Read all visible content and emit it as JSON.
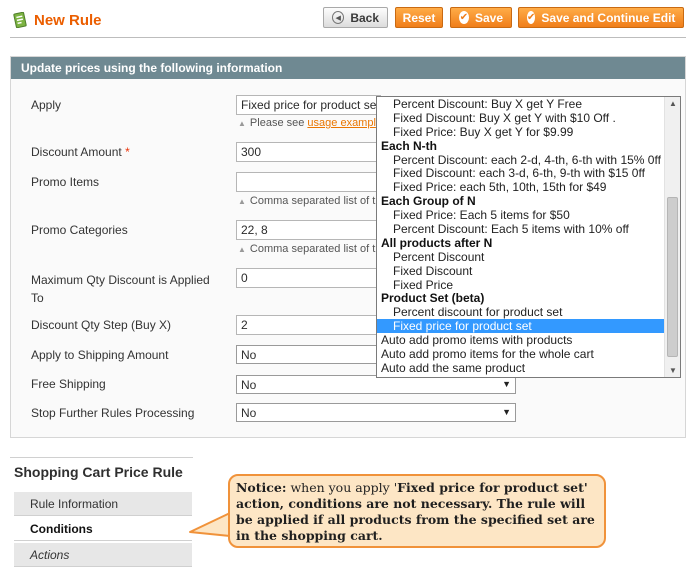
{
  "header": {
    "title": "New Rule",
    "buttons": {
      "back": "Back",
      "reset": "Reset",
      "save": "Save",
      "save_continue": "Save and Continue Edit"
    }
  },
  "section": {
    "title": "Update prices using the following information"
  },
  "form": {
    "apply": {
      "label": "Apply",
      "value": "Fixed price for product set",
      "note_prefix": "Please see",
      "note_link": "usage exampl"
    },
    "discount_amount": {
      "label": "Discount Amount",
      "required_mark": "*",
      "value": "300"
    },
    "promo_items": {
      "label": "Promo Items",
      "value": "",
      "note": "Comma separated list of th"
    },
    "promo_categories": {
      "label": "Promo Categories",
      "value": "22, 8",
      "note": "Comma separated list of th"
    },
    "max_qty": {
      "label_line1": "Maximum Qty Discount is Applied",
      "label_line2": "To",
      "value": "0"
    },
    "discount_qty_step": {
      "label": "Discount Qty Step (Buy X)",
      "value": "2"
    },
    "apply_shipping": {
      "label": "Apply to Shipping Amount",
      "value": "No"
    },
    "free_shipping": {
      "label": "Free Shipping",
      "value": "No"
    },
    "stop_rules": {
      "label": "Stop Further Rules Processing",
      "value": "No"
    }
  },
  "dropdown": {
    "items": [
      {
        "text": "Percent Discount: Buy X get Y Free",
        "kind": "option"
      },
      {
        "text": "Fixed Discount: Buy X get Y with $10 Off .",
        "kind": "option"
      },
      {
        "text": "Fixed Price: Buy X get Y for $9.99",
        "kind": "option"
      },
      {
        "text": "Each N-th",
        "kind": "group"
      },
      {
        "text": "Percent Discount: each 2-d, 4-th, 6-th with 15% 0ff",
        "kind": "option"
      },
      {
        "text": "Fixed Discount: each 3-d, 6-th, 9-th with $15 0ff",
        "kind": "option"
      },
      {
        "text": "Fixed Price: each 5th, 10th, 15th for $49",
        "kind": "option"
      },
      {
        "text": "Each Group of N",
        "kind": "group"
      },
      {
        "text": "Fixed Price: Each 5 items for $50",
        "kind": "option"
      },
      {
        "text": "Percent Discount: Each 5 items with 10% off",
        "kind": "option"
      },
      {
        "text": "All products after N",
        "kind": "group"
      },
      {
        "text": "Percent Discount",
        "kind": "option"
      },
      {
        "text": "Fixed Discount",
        "kind": "option"
      },
      {
        "text": "Fixed Price",
        "kind": "option"
      },
      {
        "text": "Product Set (beta)",
        "kind": "group"
      },
      {
        "text": "Percent discount for product set",
        "kind": "option"
      },
      {
        "text": "Fixed price for product set",
        "kind": "option",
        "selected": true
      },
      {
        "text": "Auto add promo items with products",
        "kind": "top"
      },
      {
        "text": "Auto add promo items for the whole cart",
        "kind": "top"
      },
      {
        "text": "Auto add the same product",
        "kind": "top"
      }
    ]
  },
  "sidebar": {
    "title": "Shopping Cart Price Rule",
    "items": [
      {
        "label": "Rule Information"
      },
      {
        "label": "Conditions"
      },
      {
        "label": "Actions"
      }
    ]
  },
  "notice": {
    "heading": "Notice:",
    "text_1": " when you apply '",
    "highlight": "Fixed price for product set",
    "text_2": "' action, conditions are not necessary. The rule will be applied if all products from the specified set are in the shopping cart."
  },
  "colors": {
    "accent_orange": "#eb5e00",
    "header_bar": "#6f8992",
    "selection": "#3399ff",
    "notice_bg": "#fde6c5",
    "notice_border": "#f0923a"
  }
}
